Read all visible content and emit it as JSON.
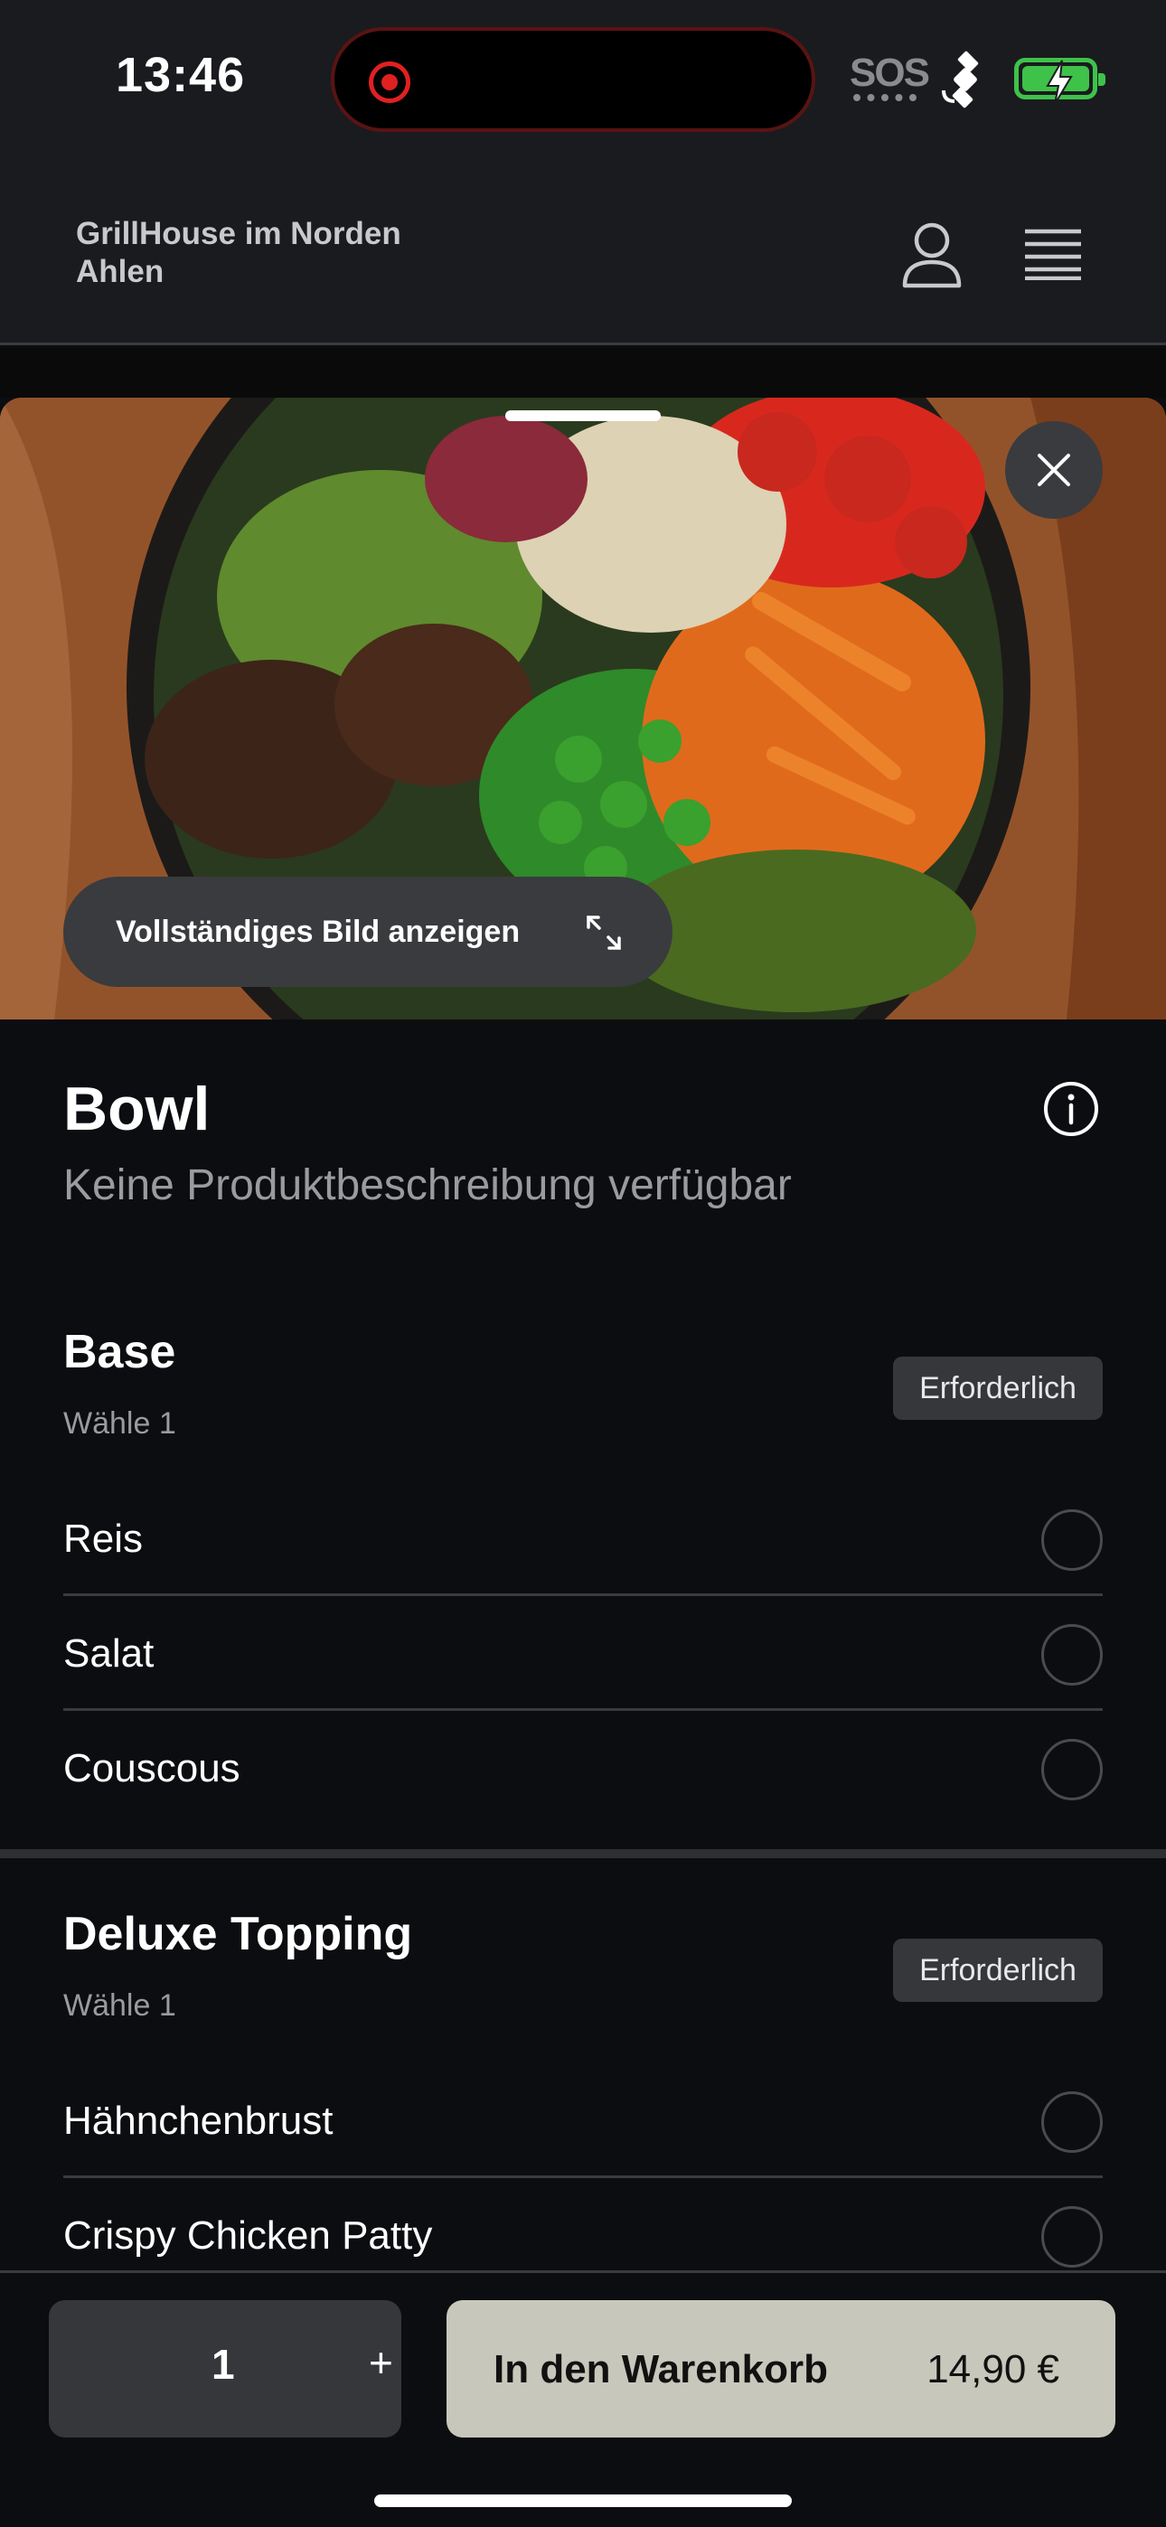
{
  "status_bar": {
    "time": "13:46",
    "sos": "SOS"
  },
  "header": {
    "restaurant_name": "GrillHouse im Norden",
    "location": "Ahlen"
  },
  "hero": {
    "full_image_label": "Vollständiges Bild anzeigen"
  },
  "product": {
    "title": "Bowl",
    "description": "Keine Produktbeschreibung verfügbar"
  },
  "sections": [
    {
      "title": "Base",
      "subtitle": "Wähle 1",
      "badge": "Erforderlich",
      "options": [
        "Reis",
        "Salat",
        "Couscous"
      ]
    },
    {
      "title": "Deluxe Topping",
      "subtitle": "Wähle 1",
      "badge": "Erforderlich",
      "options": [
        "Hähnchenbrust",
        "Crispy Chicken Patty"
      ]
    }
  ],
  "bottom_bar": {
    "quantity": "1",
    "plus": "+",
    "add_to_cart": "In den Warenkorb",
    "price": "14,90 €"
  },
  "colors": {
    "background": "#0c0d10",
    "header": "#1a1b1e",
    "cart_button": "#c8c7bb",
    "battery": "#3ec24a",
    "recording": "#e02020"
  }
}
